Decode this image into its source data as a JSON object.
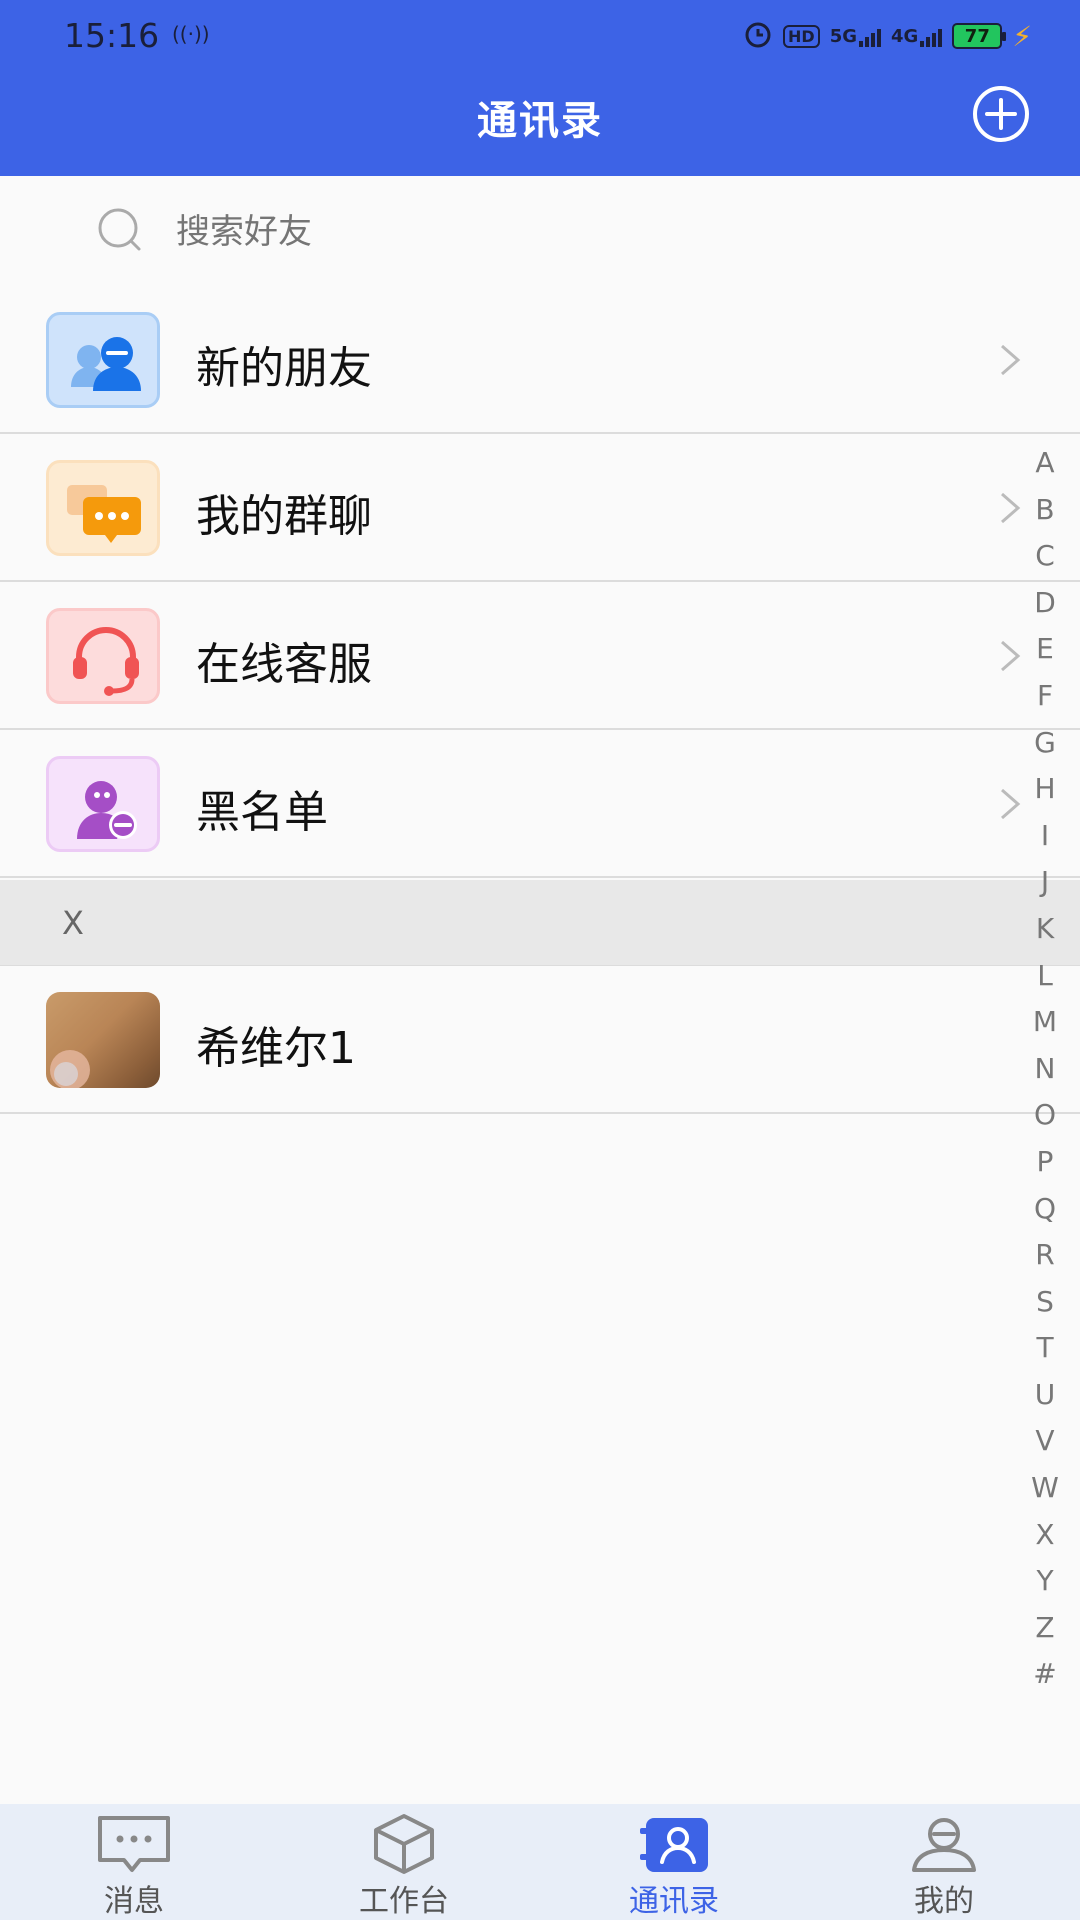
{
  "status_bar": {
    "time": "15:16",
    "network_5g": "5G",
    "network_4g": "4G",
    "hd_label": "HD",
    "battery": "77"
  },
  "header": {
    "title": "通讯录",
    "add_icon": "plus-circle-icon",
    "background_color": "#3d63e6"
  },
  "search": {
    "placeholder": "搜索好友",
    "icon": "search-icon"
  },
  "menu_items": [
    {
      "label": "新的朋友",
      "icon": "new-friends-icon"
    },
    {
      "label": "我的群聊",
      "icon": "group-chat-icon"
    },
    {
      "label": "在线客服",
      "icon": "headset-icon"
    },
    {
      "label": "黑名单",
      "icon": "blacklist-icon"
    }
  ],
  "sections": [
    {
      "letter": "X",
      "contacts": [
        {
          "name": "希维尔1",
          "avatar": "photo-avatar"
        }
      ]
    }
  ],
  "index_letters": [
    "A",
    "B",
    "C",
    "D",
    "E",
    "F",
    "G",
    "H",
    "I",
    "J",
    "K",
    "L",
    "M",
    "N",
    "O",
    "P",
    "Q",
    "R",
    "S",
    "T",
    "U",
    "V",
    "W",
    "X",
    "Y",
    "Z",
    "#"
  ],
  "tabs": [
    {
      "label": "消息",
      "icon": "message-icon",
      "active": false
    },
    {
      "label": "工作台",
      "icon": "workbench-icon",
      "active": false
    },
    {
      "label": "通讯录",
      "icon": "contacts-icon",
      "active": true
    },
    {
      "label": "我的",
      "icon": "profile-icon",
      "active": false
    }
  ],
  "colors": {
    "accent": "#3d63e6",
    "tab_bar_bg": "#e8eef8",
    "section_bg": "#e8e8e8"
  }
}
